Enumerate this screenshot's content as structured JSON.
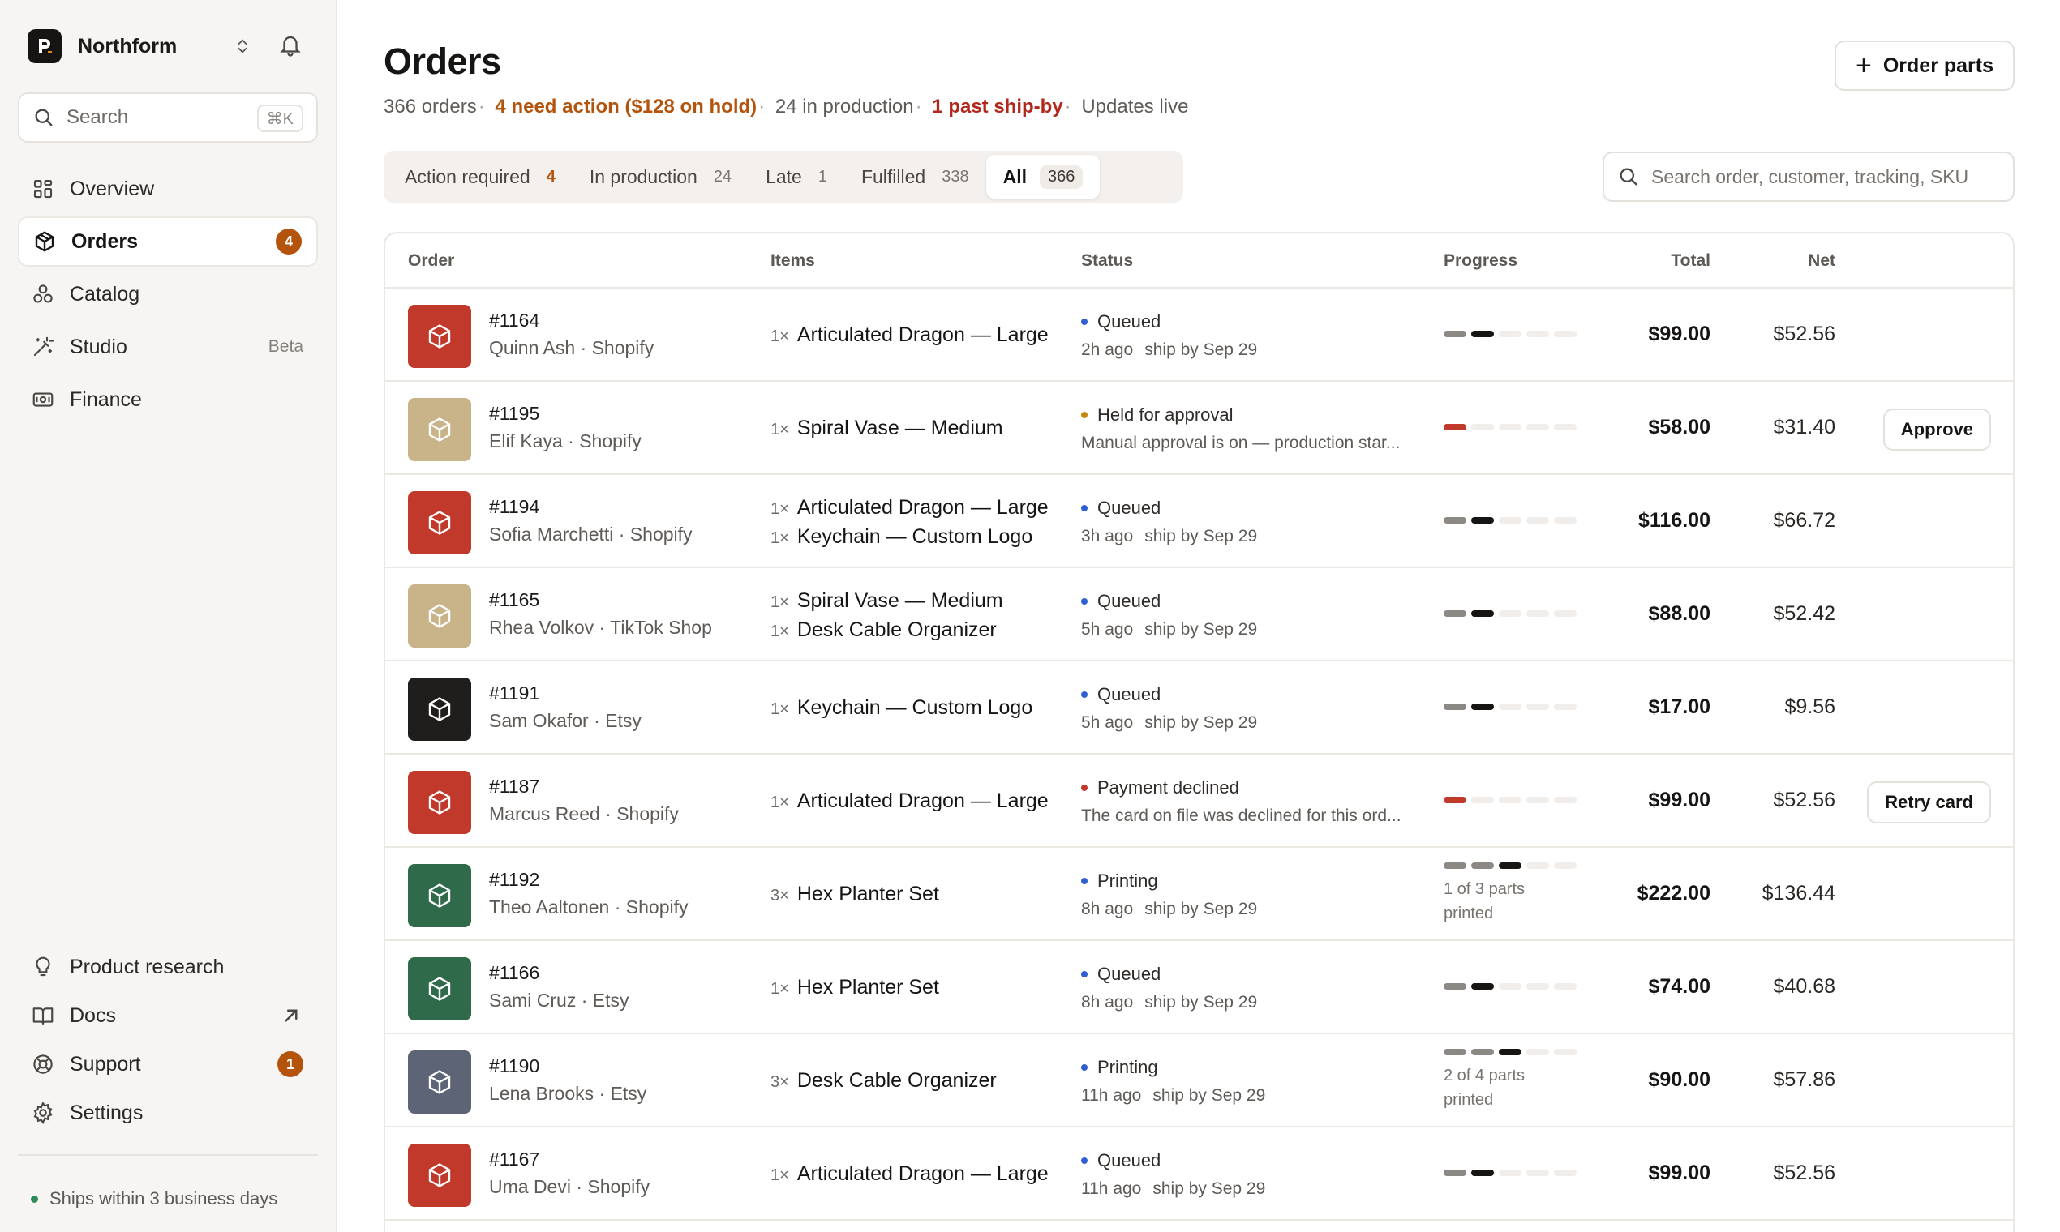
{
  "brand": {
    "name": "Northform"
  },
  "sidebar": {
    "search_label": "Search",
    "search_shortcut": "⌘K",
    "nav": [
      {
        "label": "Overview",
        "icon": "grid-icon"
      },
      {
        "label": "Orders",
        "icon": "box-icon",
        "badge": "4",
        "active": true
      },
      {
        "label": "Catalog",
        "icon": "shapes-icon"
      },
      {
        "label": "Studio",
        "icon": "wand-icon",
        "tag": "Beta"
      },
      {
        "label": "Finance",
        "icon": "banknote-icon"
      }
    ],
    "bottom": [
      {
        "label": "Product research",
        "icon": "lightbulb-icon"
      },
      {
        "label": "Docs",
        "icon": "book-icon"
      },
      {
        "label": "Support",
        "icon": "lifebuoy-icon",
        "badge": "1"
      },
      {
        "label": "Settings",
        "icon": "gear-icon"
      }
    ],
    "footer_note": "Ships within 3 business days"
  },
  "page": {
    "title": "Orders",
    "summary": {
      "orders": "366 orders",
      "action": "4 need action ($128 on hold)",
      "production": "24 in production",
      "late": "1 past ship-by",
      "live": "Updates live"
    },
    "order_parts_label": "Order parts"
  },
  "tabs": [
    {
      "label": "Action required",
      "count": "4"
    },
    {
      "label": "In production",
      "count": "24"
    },
    {
      "label": "Late",
      "count": "1"
    },
    {
      "label": "Fulfilled",
      "count": "338"
    },
    {
      "label": "All",
      "count": "366",
      "active": true
    }
  ],
  "table_search": {
    "placeholder": "Search order, customer, tracking, SKU"
  },
  "columns": {
    "order": "Order",
    "items": "Items",
    "status": "Status",
    "progress": "Progress",
    "total": "Total",
    "net": "Net"
  },
  "colors": {
    "accent_orange": "#b4540c",
    "late_red": "#b1281c",
    "dot_blue": "#2f5fd0",
    "dot_amber": "#c8860f",
    "dot_red": "#c0392b",
    "thumb_red": "#c0392b",
    "thumb_tan": "#c9b48a",
    "thumb_black": "#1f1e1c",
    "thumb_green": "#2f6b4a",
    "thumb_slate": "#5c6475"
  },
  "orders": [
    {
      "id": "#1164",
      "customer": "Quinn Ash · Shopify",
      "thumb": "red",
      "items": [
        {
          "qty": "1×",
          "name": "Articulated Dragon — Large"
        }
      ],
      "status": "Queued",
      "dot": "blue",
      "age": "2h ago",
      "ship": "ship by Sep 29",
      "progress": [
        "gray",
        "black",
        "empty",
        "empty",
        "empty"
      ],
      "total": "$99.00",
      "net": "$52.56"
    },
    {
      "id": "#1195",
      "customer": "Elif Kaya · Shopify",
      "thumb": "tan",
      "items": [
        {
          "qty": "1×",
          "name": "Spiral Vase — Medium"
        }
      ],
      "status": "Held for approval",
      "dot": "amber",
      "note": "Manual approval is on — production star...",
      "progress": [
        "red",
        "empty",
        "empty",
        "empty",
        "empty"
      ],
      "total": "$58.00",
      "net": "$31.40",
      "action": "Approve"
    },
    {
      "id": "#1194",
      "customer": "Sofia Marchetti · Shopify",
      "thumb": "red",
      "items": [
        {
          "qty": "1×",
          "name": "Articulated Dragon — Large"
        },
        {
          "qty": "1×",
          "name": "Keychain — Custom Logo"
        }
      ],
      "status": "Queued",
      "dot": "blue",
      "age": "3h ago",
      "ship": "ship by Sep 29",
      "progress": [
        "gray",
        "black",
        "empty",
        "empty",
        "empty"
      ],
      "total": "$116.00",
      "net": "$66.72"
    },
    {
      "id": "#1165",
      "customer": "Rhea Volkov · TikTok Shop",
      "thumb": "tan",
      "items": [
        {
          "qty": "1×",
          "name": "Spiral Vase — Medium"
        },
        {
          "qty": "1×",
          "name": "Desk Cable Organizer"
        }
      ],
      "status": "Queued",
      "dot": "blue",
      "age": "5h ago",
      "ship": "ship by Sep 29",
      "progress": [
        "gray",
        "black",
        "empty",
        "empty",
        "empty"
      ],
      "total": "$88.00",
      "net": "$52.42"
    },
    {
      "id": "#1191",
      "customer": "Sam Okafor · Etsy",
      "thumb": "black",
      "items": [
        {
          "qty": "1×",
          "name": "Keychain — Custom Logo"
        }
      ],
      "status": "Queued",
      "dot": "blue",
      "age": "5h ago",
      "ship": "ship by Sep 29",
      "progress": [
        "gray",
        "black",
        "empty",
        "empty",
        "empty"
      ],
      "total": "$17.00",
      "net": "$9.56"
    },
    {
      "id": "#1187",
      "customer": "Marcus Reed · Shopify",
      "thumb": "red",
      "items": [
        {
          "qty": "1×",
          "name": "Articulated Dragon — Large"
        }
      ],
      "status": "Payment declined",
      "dot": "red",
      "note": "The card on file was declined for this ord...",
      "progress": [
        "red",
        "empty",
        "empty",
        "empty",
        "empty"
      ],
      "total": "$99.00",
      "net": "$52.56",
      "action": "Retry card"
    },
    {
      "id": "#1192",
      "customer": "Theo Aaltonen · Shopify",
      "thumb": "green",
      "items": [
        {
          "qty": "3×",
          "name": "Hex Planter Set"
        }
      ],
      "status": "Printing",
      "dot": "blue",
      "age": "8h ago",
      "ship": "ship by Sep 29",
      "progress": [
        "gray",
        "gray",
        "black",
        "empty",
        "empty"
      ],
      "progress_note": "1 of 3 parts printed",
      "total": "$222.00",
      "net": "$136.44"
    },
    {
      "id": "#1166",
      "customer": "Sami Cruz · Etsy",
      "thumb": "green",
      "items": [
        {
          "qty": "1×",
          "name": "Hex Planter Set"
        }
      ],
      "status": "Queued",
      "dot": "blue",
      "age": "8h ago",
      "ship": "ship by Sep 29",
      "progress": [
        "gray",
        "black",
        "empty",
        "empty",
        "empty"
      ],
      "total": "$74.00",
      "net": "$40.68"
    },
    {
      "id": "#1190",
      "customer": "Lena Brooks · Etsy",
      "thumb": "slate",
      "items": [
        {
          "qty": "3×",
          "name": "Desk Cable Organizer"
        }
      ],
      "status": "Printing",
      "dot": "blue",
      "age": "11h ago",
      "ship": "ship by Sep 29",
      "progress": [
        "gray",
        "gray",
        "black",
        "empty",
        "empty"
      ],
      "progress_note": "2 of 4 parts printed",
      "total": "$90.00",
      "net": "$57.86"
    },
    {
      "id": "#1167",
      "customer": "Uma Devi · Shopify",
      "thumb": "red",
      "items": [
        {
          "qty": "1×",
          "name": "Articulated Dragon — Large"
        }
      ],
      "status": "Queued",
      "dot": "blue",
      "age": "11h ago",
      "ship": "ship by Sep 29",
      "progress": [
        "gray",
        "black",
        "empty",
        "empty",
        "empty"
      ],
      "total": "$99.00",
      "net": "$52.56"
    }
  ]
}
